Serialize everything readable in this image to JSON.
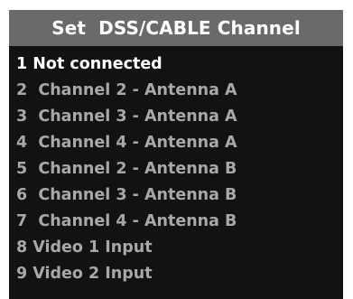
{
  "menu": {
    "title": "Set  DSS/CABLE Channel",
    "colors": {
      "panel_background": "#121212",
      "header_background": "#6a6a6a",
      "selected_text": "#ffffff",
      "unselected_text": "#a8a8a8"
    },
    "selected_index": 0,
    "items": [
      {
        "label": "1 Not connected",
        "selected": true
      },
      {
        "label": "2  Channel 2 - Antenna A",
        "selected": false
      },
      {
        "label": "3  Channel 3 - Antenna A",
        "selected": false
      },
      {
        "label": "4  Channel 4 - Antenna A",
        "selected": false
      },
      {
        "label": "5  Channel 2 - Antenna B",
        "selected": false
      },
      {
        "label": "6  Channel 3 - Antenna B",
        "selected": false
      },
      {
        "label": "7  Channel 4 - Antenna B",
        "selected": false
      },
      {
        "label": "8 Video 1 Input",
        "selected": false
      },
      {
        "label": "9 Video 2 Input",
        "selected": false
      }
    ]
  }
}
